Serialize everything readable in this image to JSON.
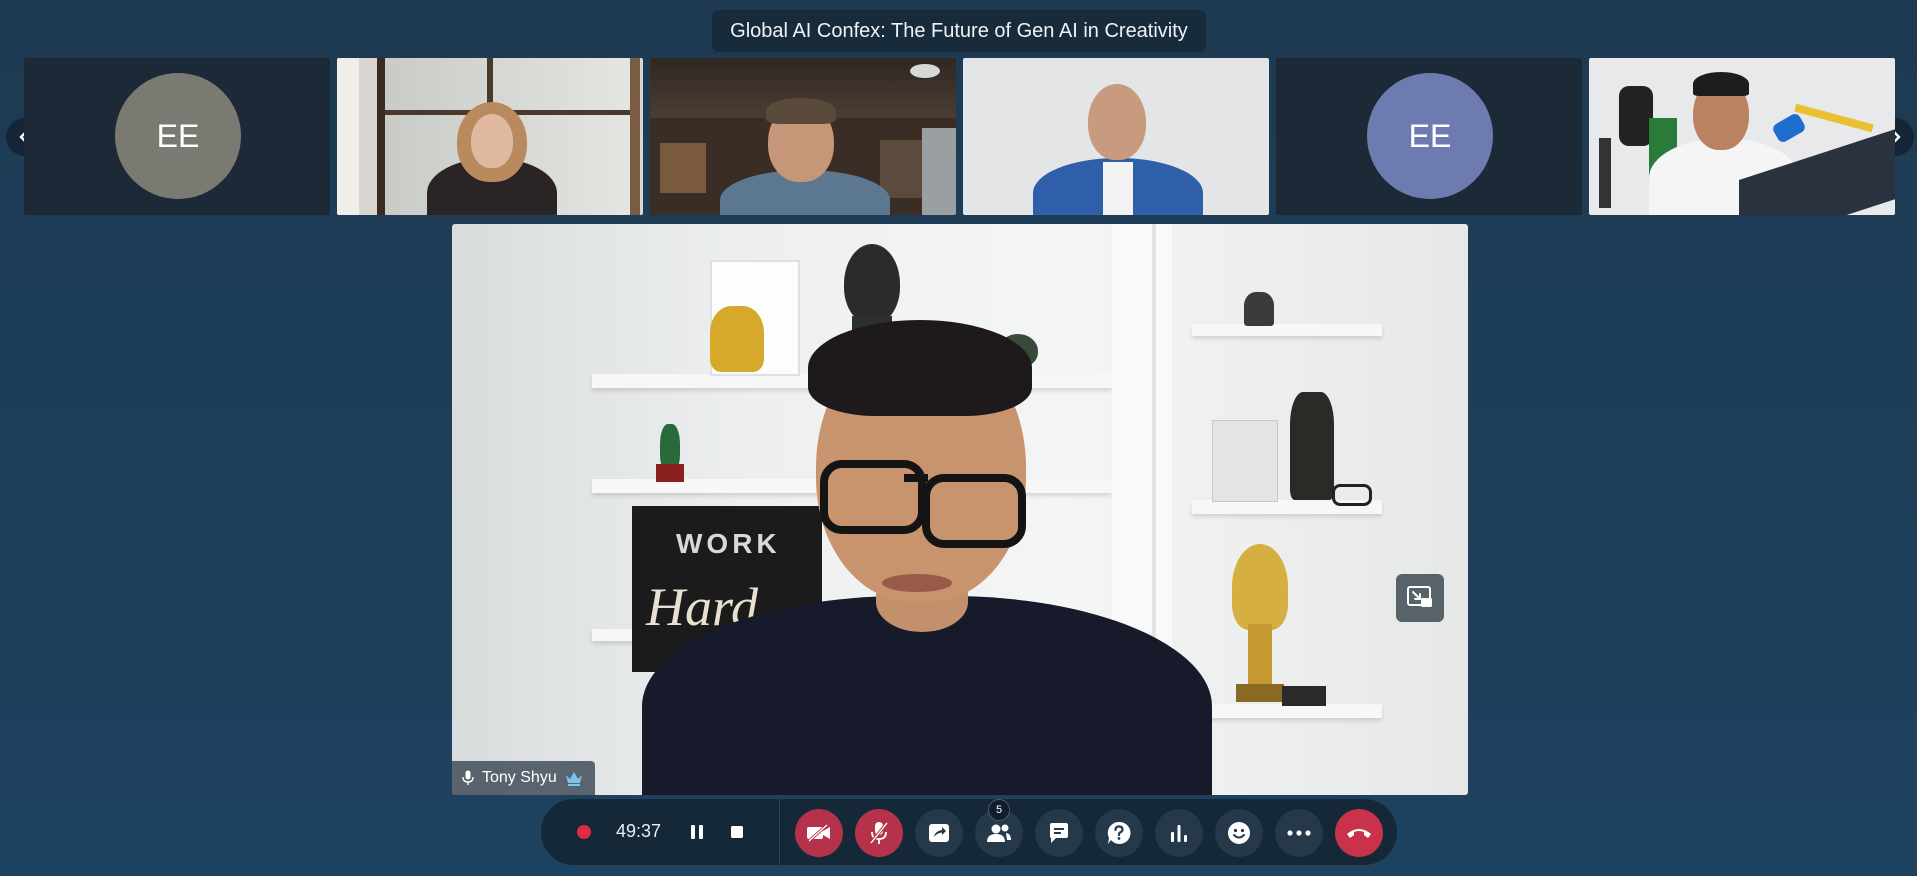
{
  "meeting": {
    "title": "Global AI Confex: The Future of Gen AI in Creativity"
  },
  "nav": {
    "prev_icon": "chevron-left-icon",
    "next_icon": "chevron-right-icon"
  },
  "participants": [
    {
      "type": "avatar",
      "initials": "EE",
      "avatar_color": "#7a7a72"
    },
    {
      "type": "video"
    },
    {
      "type": "video"
    },
    {
      "type": "video"
    },
    {
      "type": "avatar",
      "initials": "EE",
      "avatar_color": "#6e7bb0"
    },
    {
      "type": "video"
    }
  ],
  "main_speaker": {
    "name": "Tony Shyu",
    "poster_text_1": "WORK",
    "poster_text_2": "Hard"
  },
  "recording": {
    "elapsed": "49:37"
  },
  "toolbar": {
    "participants_count": "5"
  },
  "colors": {
    "accent_red": "#b5334a",
    "record_red": "#e02c40",
    "hangup": "#c8324a"
  }
}
